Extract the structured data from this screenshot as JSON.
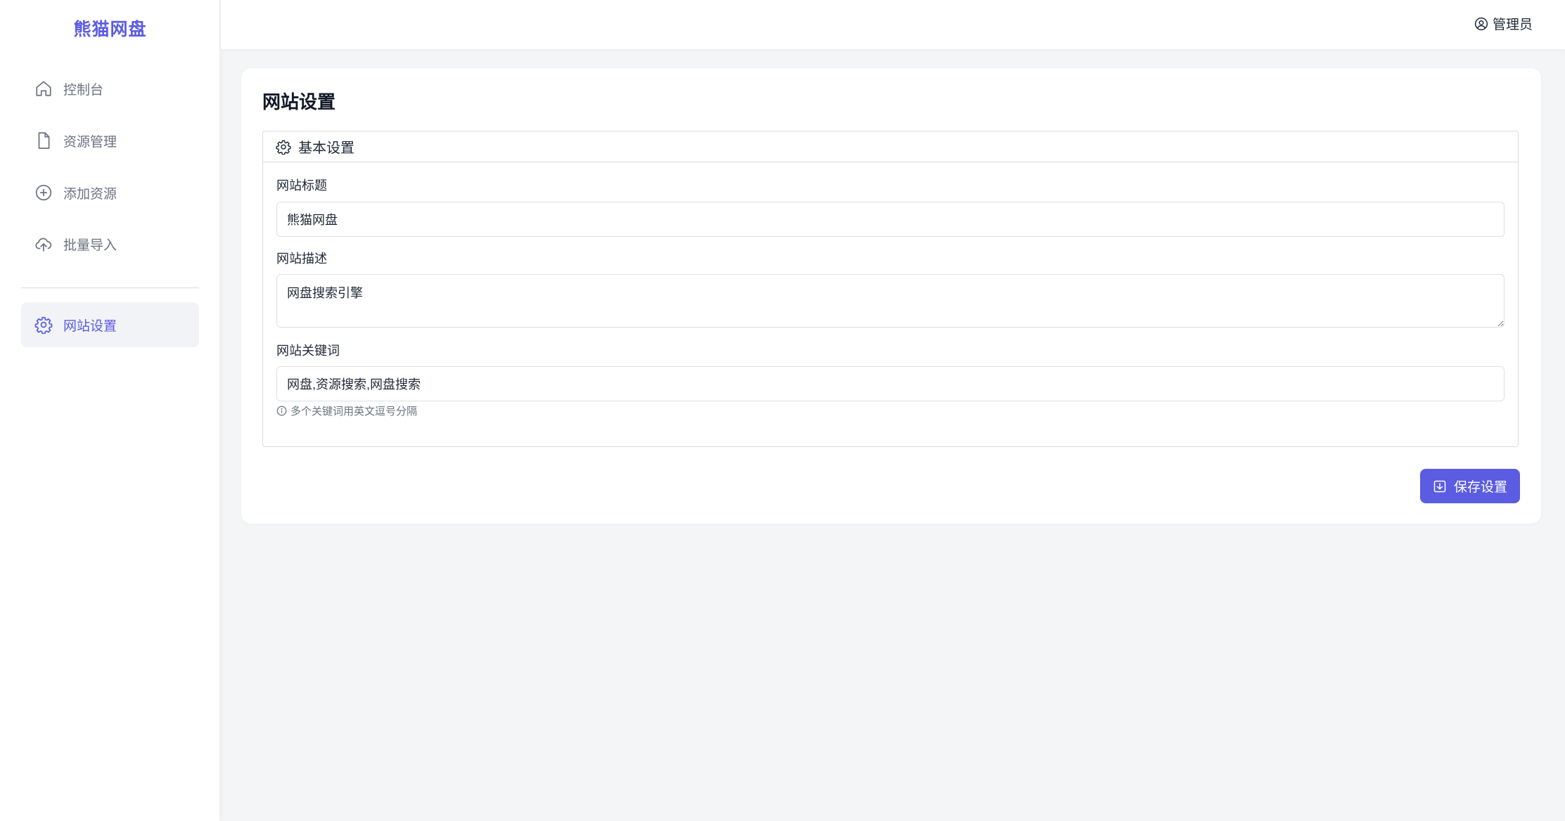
{
  "app": {
    "logo_text": "熊猫网盘"
  },
  "sidebar": {
    "items": [
      {
        "label": "控制台",
        "icon": "home-icon",
        "active": false
      },
      {
        "label": "资源管理",
        "icon": "file-icon",
        "active": false
      },
      {
        "label": "添加资源",
        "icon": "plus-circle-icon",
        "active": false
      },
      {
        "label": "批量导入",
        "icon": "cloud-upload-icon",
        "active": false
      },
      {
        "label": "网站设置",
        "icon": "gear-icon",
        "active": true
      }
    ]
  },
  "header": {
    "user_label": "管理员",
    "user_icon": "user-circle-icon"
  },
  "main": {
    "page_title": "网站设置",
    "section": {
      "title": "基本设置",
      "icon": "gear-icon",
      "fields": {
        "site_title": {
          "label": "网站标题",
          "value": "熊猫网盘"
        },
        "site_description": {
          "label": "网站描述",
          "value": "网盘搜索引擎"
        },
        "site_keywords": {
          "label": "网站关键词",
          "value": "网盘,资源搜索,网盘搜索",
          "hint": "多个关键词用英文逗号分隔"
        }
      }
    },
    "save_button_label": "保存设置"
  },
  "colors": {
    "accent": "#5b5ce2",
    "active_bg": "#f2f3f6",
    "page_bg": "#f4f5f7"
  }
}
